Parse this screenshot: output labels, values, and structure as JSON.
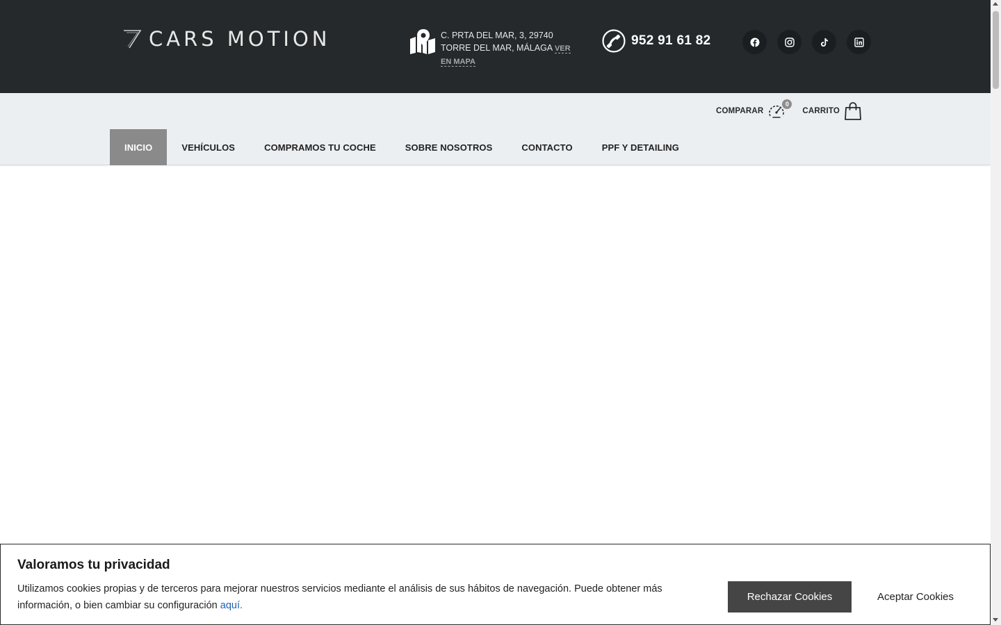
{
  "header": {
    "logo_text": "CARS MOTION",
    "address_line1": "C. PRTA DEL MAR, 3, 29740",
    "address_line2": "TORRE DEL MAR, MÁLAGA",
    "map_link_label": "VER EN MAPA",
    "phone": "952 91 61 82",
    "socials": [
      {
        "icon": "facebook-icon"
      },
      {
        "icon": "instagram-icon"
      },
      {
        "icon": "tiktok-icon"
      },
      {
        "icon": "linkedin-icon"
      }
    ]
  },
  "utility": {
    "compare_label": "COMPARAR",
    "compare_count": "0",
    "cart_label": "CARRITO"
  },
  "nav": {
    "items": [
      {
        "label": "INICIO",
        "active": true
      },
      {
        "label": "VEHÍCULOS",
        "active": false
      },
      {
        "label": "COMPRAMOS TU COCHE",
        "active": false
      },
      {
        "label": "SOBRE NOSOTROS",
        "active": false
      },
      {
        "label": "CONTACTO",
        "active": false
      },
      {
        "label": "PPF Y DETAILING",
        "active": false
      }
    ]
  },
  "cookie": {
    "title": "Valoramos tu privacidad",
    "text": "Utilizamos cookies propias y de terceros para mejorar nuestros servicios mediante el análisis de sus hábitos de navegación. Puede obtener más información, o bien cambiar su configuración ",
    "link_label": "aquí.",
    "reject_label": "Rechazar Cookies",
    "accept_label": "Aceptar Cookies"
  },
  "colors": {
    "header_bg": "#25292c",
    "nav_bg": "#eceff2",
    "active_nav": "#8a8a8a",
    "reject_button": "#454545",
    "link": "#1f5fb4"
  }
}
